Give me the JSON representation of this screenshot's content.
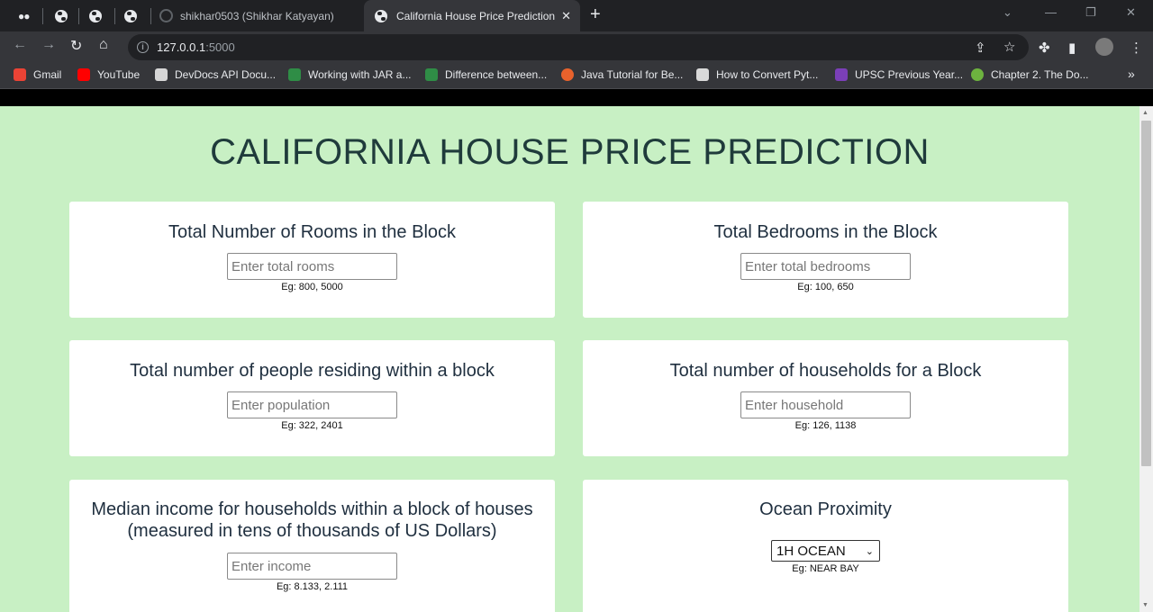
{
  "browser": {
    "tabs": [
      {
        "label": "",
        "icon": "medium-icon"
      },
      {
        "label": "",
        "icon": "globe-icon"
      },
      {
        "label": "",
        "icon": "globe-icon"
      },
      {
        "label": "",
        "icon": "globe-icon"
      },
      {
        "label": "shikhar0503 (Shikhar Katyayan)",
        "icon": "github-icon"
      },
      {
        "label": "California House Price Prediction",
        "icon": "globe-icon",
        "active": true
      }
    ],
    "url_host": "127.0.0.1",
    "url_port": ":5000",
    "bookmarks": [
      {
        "label": "Gmail",
        "color": "#ea4335"
      },
      {
        "label": "YouTube",
        "color": "#ff0000"
      },
      {
        "label": "DevDocs API Docu...",
        "color": "#d6d6d6"
      },
      {
        "label": "Working with JAR a...",
        "color": "#2f8d46"
      },
      {
        "label": "Difference between...",
        "color": "#2f8d46"
      },
      {
        "label": "Java Tutorial for Be...",
        "color": "#e8622c"
      },
      {
        "label": "How to Convert Pyt...",
        "color": "#d9d9d9"
      },
      {
        "label": "UPSC Previous Year...",
        "color": "#7b3fb8"
      },
      {
        "label": "Chapter 2. The Do...",
        "color": "#6db33f"
      }
    ],
    "more_bookmarks": "»"
  },
  "page": {
    "title": "CALIFORNIA HOUSE PRICE PREDICTION",
    "cards": [
      {
        "heading": "Total Number of Rooms in the Block",
        "placeholder": "Enter total rooms",
        "hint": "Eg: 800, 5000"
      },
      {
        "heading": "Total Bedrooms in the Block",
        "placeholder": "Enter total bedrooms",
        "hint": "Eg: 100, 650"
      },
      {
        "heading": "Total number of people residing within a block",
        "placeholder": "Enter population",
        "hint": "Eg: 322, 2401"
      },
      {
        "heading": "Total number of households for a Block",
        "placeholder": "Enter household",
        "hint": "Eg: 126, 1138"
      },
      {
        "heading": "Median income for households within a block of houses (measured in tens of thousands of US Dollars)",
        "placeholder": "Enter income",
        "hint": "Eg: 8.133, 2.111"
      },
      {
        "heading": "Ocean Proximity",
        "select_value": "1H OCEAN",
        "hint": "Eg: NEAR BAY"
      }
    ]
  },
  "colors": {
    "page_bg": "#c8f0c4",
    "title_color": "#1f3b3b",
    "chrome_dark": "#202124",
    "chrome_toolbar": "#35363a"
  }
}
